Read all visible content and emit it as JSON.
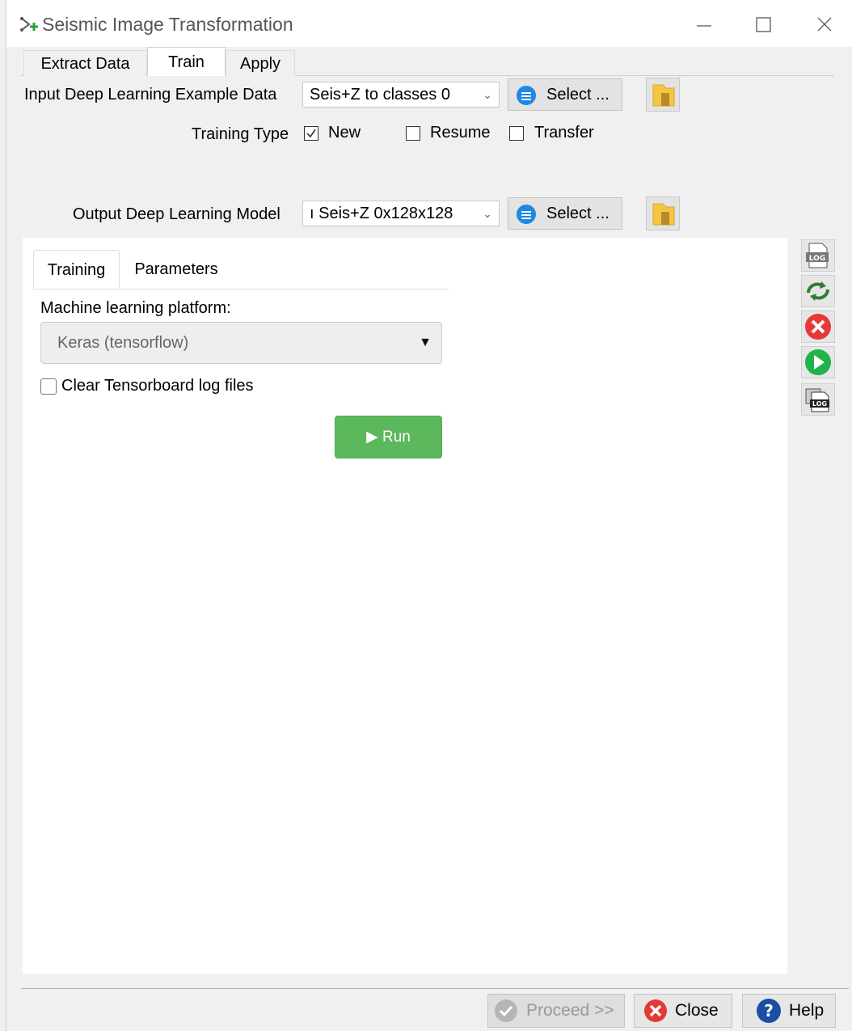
{
  "window": {
    "title": "Seismic Image Transformation"
  },
  "main_tabs": [
    {
      "label": "Extract Data",
      "active": false
    },
    {
      "label": "Train",
      "active": true
    },
    {
      "label": "Apply",
      "active": false
    }
  ],
  "input": {
    "label": "Input Deep Learning Example Data",
    "value": "Seis+Z  to  classes  0",
    "select_label": "Select ..."
  },
  "training_type": {
    "label": "Training Type",
    "options": [
      {
        "label": "New",
        "checked": true
      },
      {
        "label": "Resume",
        "checked": false
      },
      {
        "label": "Transfer",
        "checked": false
      }
    ]
  },
  "output": {
    "label": "Output Deep Learning Model",
    "value": "ı  Seis+Z  0x128x128",
    "select_label": "Select ..."
  },
  "sub_tabs": [
    {
      "label": "Training",
      "active": true
    },
    {
      "label": "Parameters",
      "active": false
    }
  ],
  "platform": {
    "label": "Machine learning platform:",
    "value": "Keras (tensorflow)"
  },
  "clear_logs": {
    "label": "Clear Tensorboard log files",
    "checked": false
  },
  "run": {
    "label": "Run"
  },
  "side_tools": [
    {
      "icon": "log-file-icon"
    },
    {
      "icon": "refresh-icon"
    },
    {
      "icon": "stop-icon"
    },
    {
      "icon": "play-icon"
    },
    {
      "icon": "log-stack-icon"
    }
  ],
  "footer": {
    "proceed_label": "Proceed >>",
    "close_label": "Close",
    "help_label": "Help"
  },
  "colors": {
    "accent_blue": "#1e88e5",
    "run_green": "#5cb85c",
    "stop_red": "#e53935",
    "play_green": "#21b24b",
    "help_blue": "#1a4fa3"
  }
}
